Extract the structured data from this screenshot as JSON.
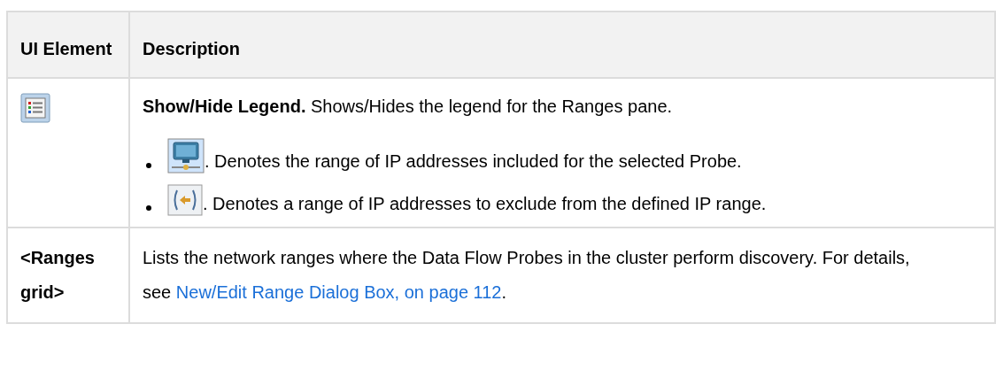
{
  "table": {
    "columns": [
      "UI Element",
      "Description"
    ],
    "rows": [
      {
        "element": {
          "kind": "icon"
        },
        "description": "**Show/Hide Legend.** Shows/Hides the legend for the Ranges pane.",
        "bullets": [
          {
            "kind": "monitor",
            "text": ". Denotes the range of IP addresses included for the selected Probe."
          },
          {
            "kind": "exclude",
            "text": ". Denotes a range of IP addresses to exclude from the defined IP range."
          }
        ]
      },
      {
        "element": {
          "kind": "text",
          "label": "<Ranges grid>"
        },
        "description": "Lists the network ranges where the Data Flow Probes in the cluster perform discovery. For details, see ",
        "link": "New/Edit Range Dialog Box, on page 112",
        "after": "."
      }
    ]
  }
}
